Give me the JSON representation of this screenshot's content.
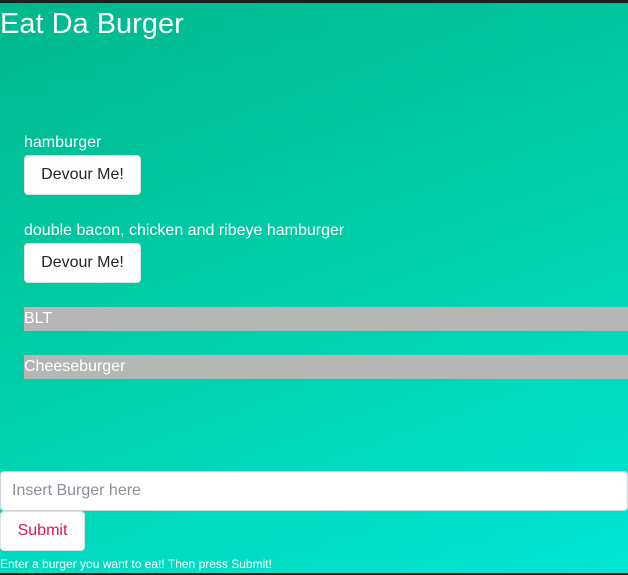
{
  "app": {
    "title": "Eat Da Burger"
  },
  "burgers_to_eat": [
    {
      "name": "hamburger",
      "button_label": "Devour Me!"
    },
    {
      "name": "double bacon, chicken and ribeye hamburger",
      "button_label": "Devour Me!"
    }
  ],
  "burgers_devoured": [
    {
      "name": "BLT"
    },
    {
      "name": "Cheeseburger"
    }
  ],
  "form": {
    "input_placeholder": "Insert Burger here",
    "input_value": "",
    "submit_label": "Submit",
    "help_text": "Enter a burger you want to eat! Then press Submit!"
  },
  "colors": {
    "gradient_start": "#00b88c",
    "gradient_end": "#00e6d6",
    "devoured_bar": "#b6b6b6",
    "submit_text": "#e0115f"
  }
}
